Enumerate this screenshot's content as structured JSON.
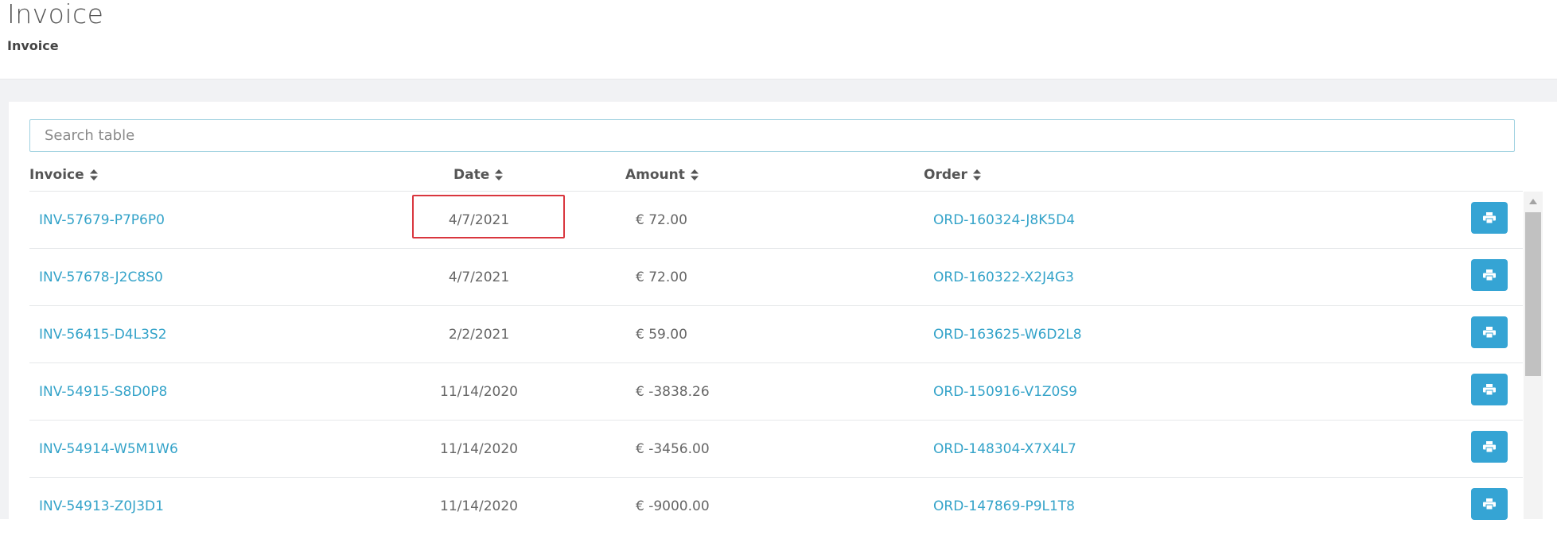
{
  "page": {
    "title": "Invoice",
    "breadcrumb": "Invoice"
  },
  "search": {
    "placeholder": "Search table",
    "value": ""
  },
  "table": {
    "columns": [
      {
        "label": "Invoice"
      },
      {
        "label": "Date"
      },
      {
        "label": "Amount"
      },
      {
        "label": "Order"
      }
    ],
    "rows": [
      {
        "invoice": "INV-57679-P7P6P0",
        "date": "4/7/2021",
        "amount": "€ 72.00",
        "order": "ORD-160324-J8K5D4"
      },
      {
        "invoice": "INV-57678-J2C8S0",
        "date": "4/7/2021",
        "amount": "€ 72.00",
        "order": "ORD-160322-X2J4G3"
      },
      {
        "invoice": "INV-56415-D4L3S2",
        "date": "2/2/2021",
        "amount": "€ 59.00",
        "order": "ORD-163625-W6D2L8"
      },
      {
        "invoice": "INV-54915-S8D0P8",
        "date": "11/14/2020",
        "amount": "€ -3838.26",
        "order": "ORD-150916-V1Z0S9"
      },
      {
        "invoice": "INV-54914-W5M1W6",
        "date": "11/14/2020",
        "amount": "€ -3456.00",
        "order": "ORD-148304-X7X4L7"
      },
      {
        "invoice": "INV-54913-Z0J3D1",
        "date": "11/14/2020",
        "amount": "€ -9000.00",
        "order": "ORD-147869-P9L1T8"
      }
    ],
    "row_action_icon": "print-icon",
    "sort_icon": "sort-icon"
  },
  "colors": {
    "link": "#34a3c9",
    "print_button": "#35a4d4",
    "highlight": "#d9363e"
  }
}
